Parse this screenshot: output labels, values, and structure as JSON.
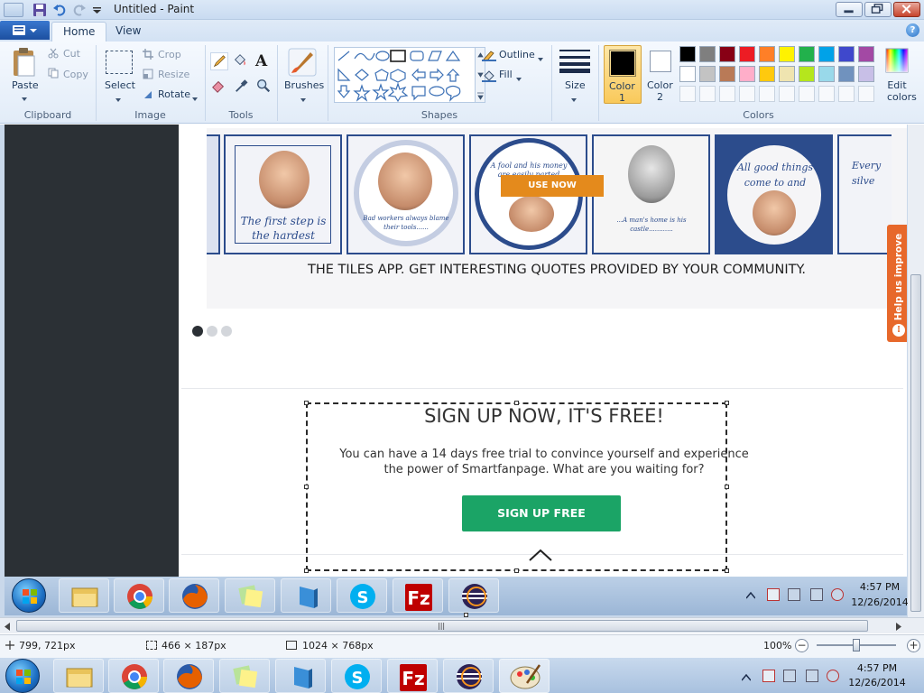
{
  "window": {
    "title": "Untitled - Paint"
  },
  "ribbon": {
    "tabs": [
      "Home",
      "View"
    ],
    "clipboard": {
      "paste": "Paste",
      "cut": "Cut",
      "copy": "Copy",
      "label": "Clipboard"
    },
    "image": {
      "select": "Select",
      "crop": "Crop",
      "resize": "Resize",
      "rotate": "Rotate",
      "label": "Image"
    },
    "tools": {
      "label": "Tools",
      "text_tool_glyph": "A"
    },
    "brushes": {
      "label": "Brushes"
    },
    "shapes": {
      "outline": "Outline",
      "fill": "Fill",
      "label": "Shapes"
    },
    "size": {
      "label": "Size"
    },
    "color1": {
      "label": "Color",
      "num": "1",
      "value": "#000000"
    },
    "color2": {
      "label": "Color",
      "num": "2",
      "value": "#ffffff"
    },
    "colors": {
      "label": "Colors",
      "edit_colors": "Edit colors",
      "row1": [
        "#000000",
        "#7f7f7f",
        "#880015",
        "#ed1c24",
        "#ff7f27",
        "#fff200",
        "#22b14c",
        "#00a2e8",
        "#3f48cc",
        "#a349a4"
      ],
      "row2": [
        "#ffffff",
        "#c3c3c3",
        "#b97a57",
        "#ffaec9",
        "#ffc90e",
        "#efe4b0",
        "#b5e61d",
        "#99d9ea",
        "#7092be",
        "#c8bfe7"
      ]
    }
  },
  "web": {
    "tiles": [
      {
        "quote": "The first step is the hardest"
      },
      {
        "quote": "Bad workers always blame their tools......"
      },
      {
        "quote": "A fool and his money are easily parted"
      },
      {
        "quote": "...A man's home is his castle............"
      },
      {
        "quote": "All good things come to and"
      },
      {
        "quote": "Every silve"
      }
    ],
    "use_now": "USE NOW",
    "tagline": "THE TILES APP. GET INTERESTING QUOTES PROVIDED BY YOUR COMMUNITY.",
    "help_tab": "Help us improve",
    "signup": {
      "heading": "SIGN UP NOW, IT'S FREE!",
      "body_line1": "You can have a 14 days free trial to convince yourself and experience",
      "body_line2": "the power of Smartfanpage. What are you waiting for?",
      "button": "SIGN UP FREE"
    }
  },
  "inner_taskbar": {
    "time": "4:57 PM",
    "date": "12/26/2014"
  },
  "statusbar": {
    "cursor_pos": "799, 721px",
    "selection_size": "466 × 187px",
    "image_size": "1024 × 768px",
    "zoom": "100%",
    "zoom_level": 1.0
  },
  "outer_taskbar": {
    "time": "4:57 PM",
    "date": "12/26/2014"
  },
  "accent": {
    "signup_green": "#1ba466",
    "use_now_orange": "#e48a1c",
    "dark_sidebar": "#2b3035",
    "tile_blue": "#2c4c8c"
  }
}
